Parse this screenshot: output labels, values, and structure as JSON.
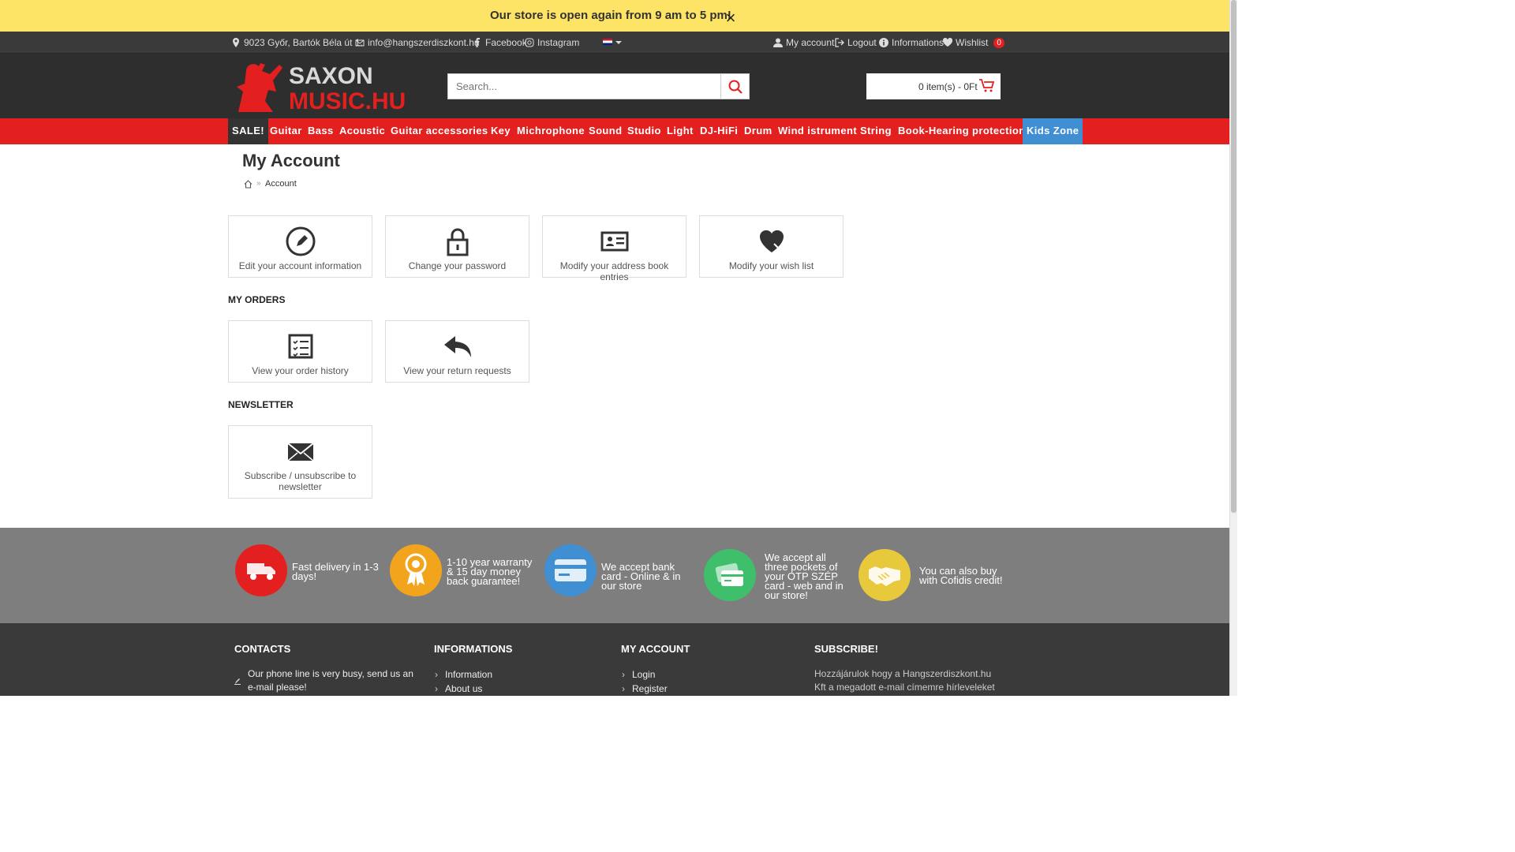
{
  "notice": {
    "text": "Our store is open again from 9 am to 5 pm!",
    "close": "×"
  },
  "topbar": {
    "address": "9023 Győr, Bartók Béla út 1.",
    "email": "info@hangszerdiszkont.hu",
    "facebook": "Facebook",
    "instagram": "Instagram",
    "my_account": "My account",
    "logout": "Logout",
    "informations": "Informations",
    "wishlist": "Wishlist",
    "wishlist_count": "0"
  },
  "header": {
    "logo_line1": "SAXON",
    "logo_line2": "MUSIC.HU",
    "search_placeholder": "Search...",
    "cart_text": "0 item(s) - 0Ft"
  },
  "nav": [
    "SALE!",
    "Guitar",
    "Bass",
    "Acoustic",
    "Guitar accessories",
    "Key",
    "Michrophone",
    "Sound",
    "Studio",
    "Light",
    "DJ-HiFi",
    "Drum",
    "Wind istrument",
    "String",
    "Book-Hearing protection",
    "Kids Zone"
  ],
  "page": {
    "title": "My Account",
    "breadcrumb": "Account",
    "tiles_account": [
      {
        "label": "Edit your account information",
        "icon": "pencil-icon"
      },
      {
        "label": "Change your password",
        "icon": "lock-icon"
      },
      {
        "label": "Modify your address book entries",
        "icon": "address-card-icon"
      },
      {
        "label": "Modify your wish list",
        "icon": "heart-icon"
      }
    ],
    "orders_heading": "MY ORDERS",
    "tiles_orders": [
      {
        "label": "View your order history",
        "icon": "checklist-icon"
      },
      {
        "label": "View your return requests",
        "icon": "reply-icon"
      }
    ],
    "newsletter_heading": "NEWSLETTER",
    "tiles_newsletter": [
      {
        "label": "Subscribe / unsubscribe to newsletter",
        "icon": "envelope-icon"
      }
    ]
  },
  "features": [
    {
      "text": "Fast delivery in 1-3 days!",
      "color": "#e3201f",
      "icon": "truck-icon"
    },
    {
      "text": "1-10 year warranty & 15 day money back guarantee!",
      "color": "#f2a51c",
      "icon": "award-icon"
    },
    {
      "text": "We accept bank card - Online & in our store",
      "color": "#3f8fd2",
      "icon": "credit-card-icon"
    },
    {
      "text": "We accept all three pockets of your OTP SZÉP card - web and in our store!",
      "color": "#3fbf6b",
      "icon": "cards-icon"
    },
    {
      "text": "You can also buy with Cofidis credit!",
      "color": "#e9c93c",
      "icon": "handshake-icon"
    }
  ],
  "footer": {
    "contacts_heading": "CONTACTS",
    "contacts_text": "Our phone line is very busy, send us an e-mail please!",
    "informations_heading": "INFORMATIONS",
    "informations_links": [
      "Information",
      "About us"
    ],
    "account_heading": "MY ACCOUNT",
    "account_links": [
      "Login",
      "Register"
    ],
    "subscribe_heading": "SUBSCRIBE!",
    "subscribe_text_1": "Hozzájárulok hogy a Hangszerdiszkont.hu",
    "subscribe_text_2": "Kft a megadott e-mail címemre hírleveleket"
  }
}
